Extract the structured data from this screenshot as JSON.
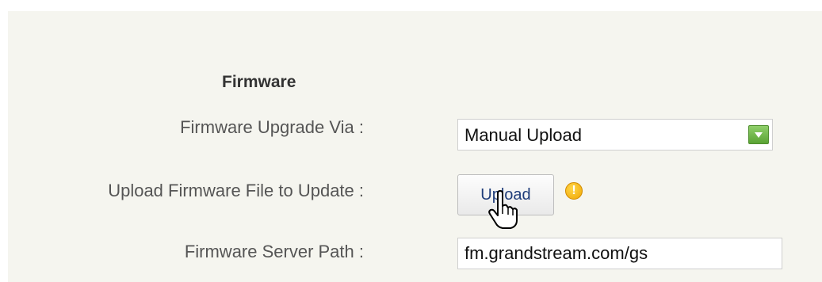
{
  "section": {
    "title": "Firmware"
  },
  "fields": {
    "upgrade_via": {
      "label": "Firmware Upgrade Via :",
      "selected": "Manual Upload"
    },
    "upload_file": {
      "label": "Upload Firmware File to Update :",
      "button_label": "Upload",
      "info_icon": "warning-icon"
    },
    "server_path": {
      "label": "Firmware Server Path :",
      "value": "fm.grandstream.com/gs"
    }
  },
  "colors": {
    "panel_bg": "#f5f5ef",
    "dropdown_arrow": "#6bb43f",
    "info_icon": "#f0a500",
    "button_text": "#1f3d7a"
  }
}
